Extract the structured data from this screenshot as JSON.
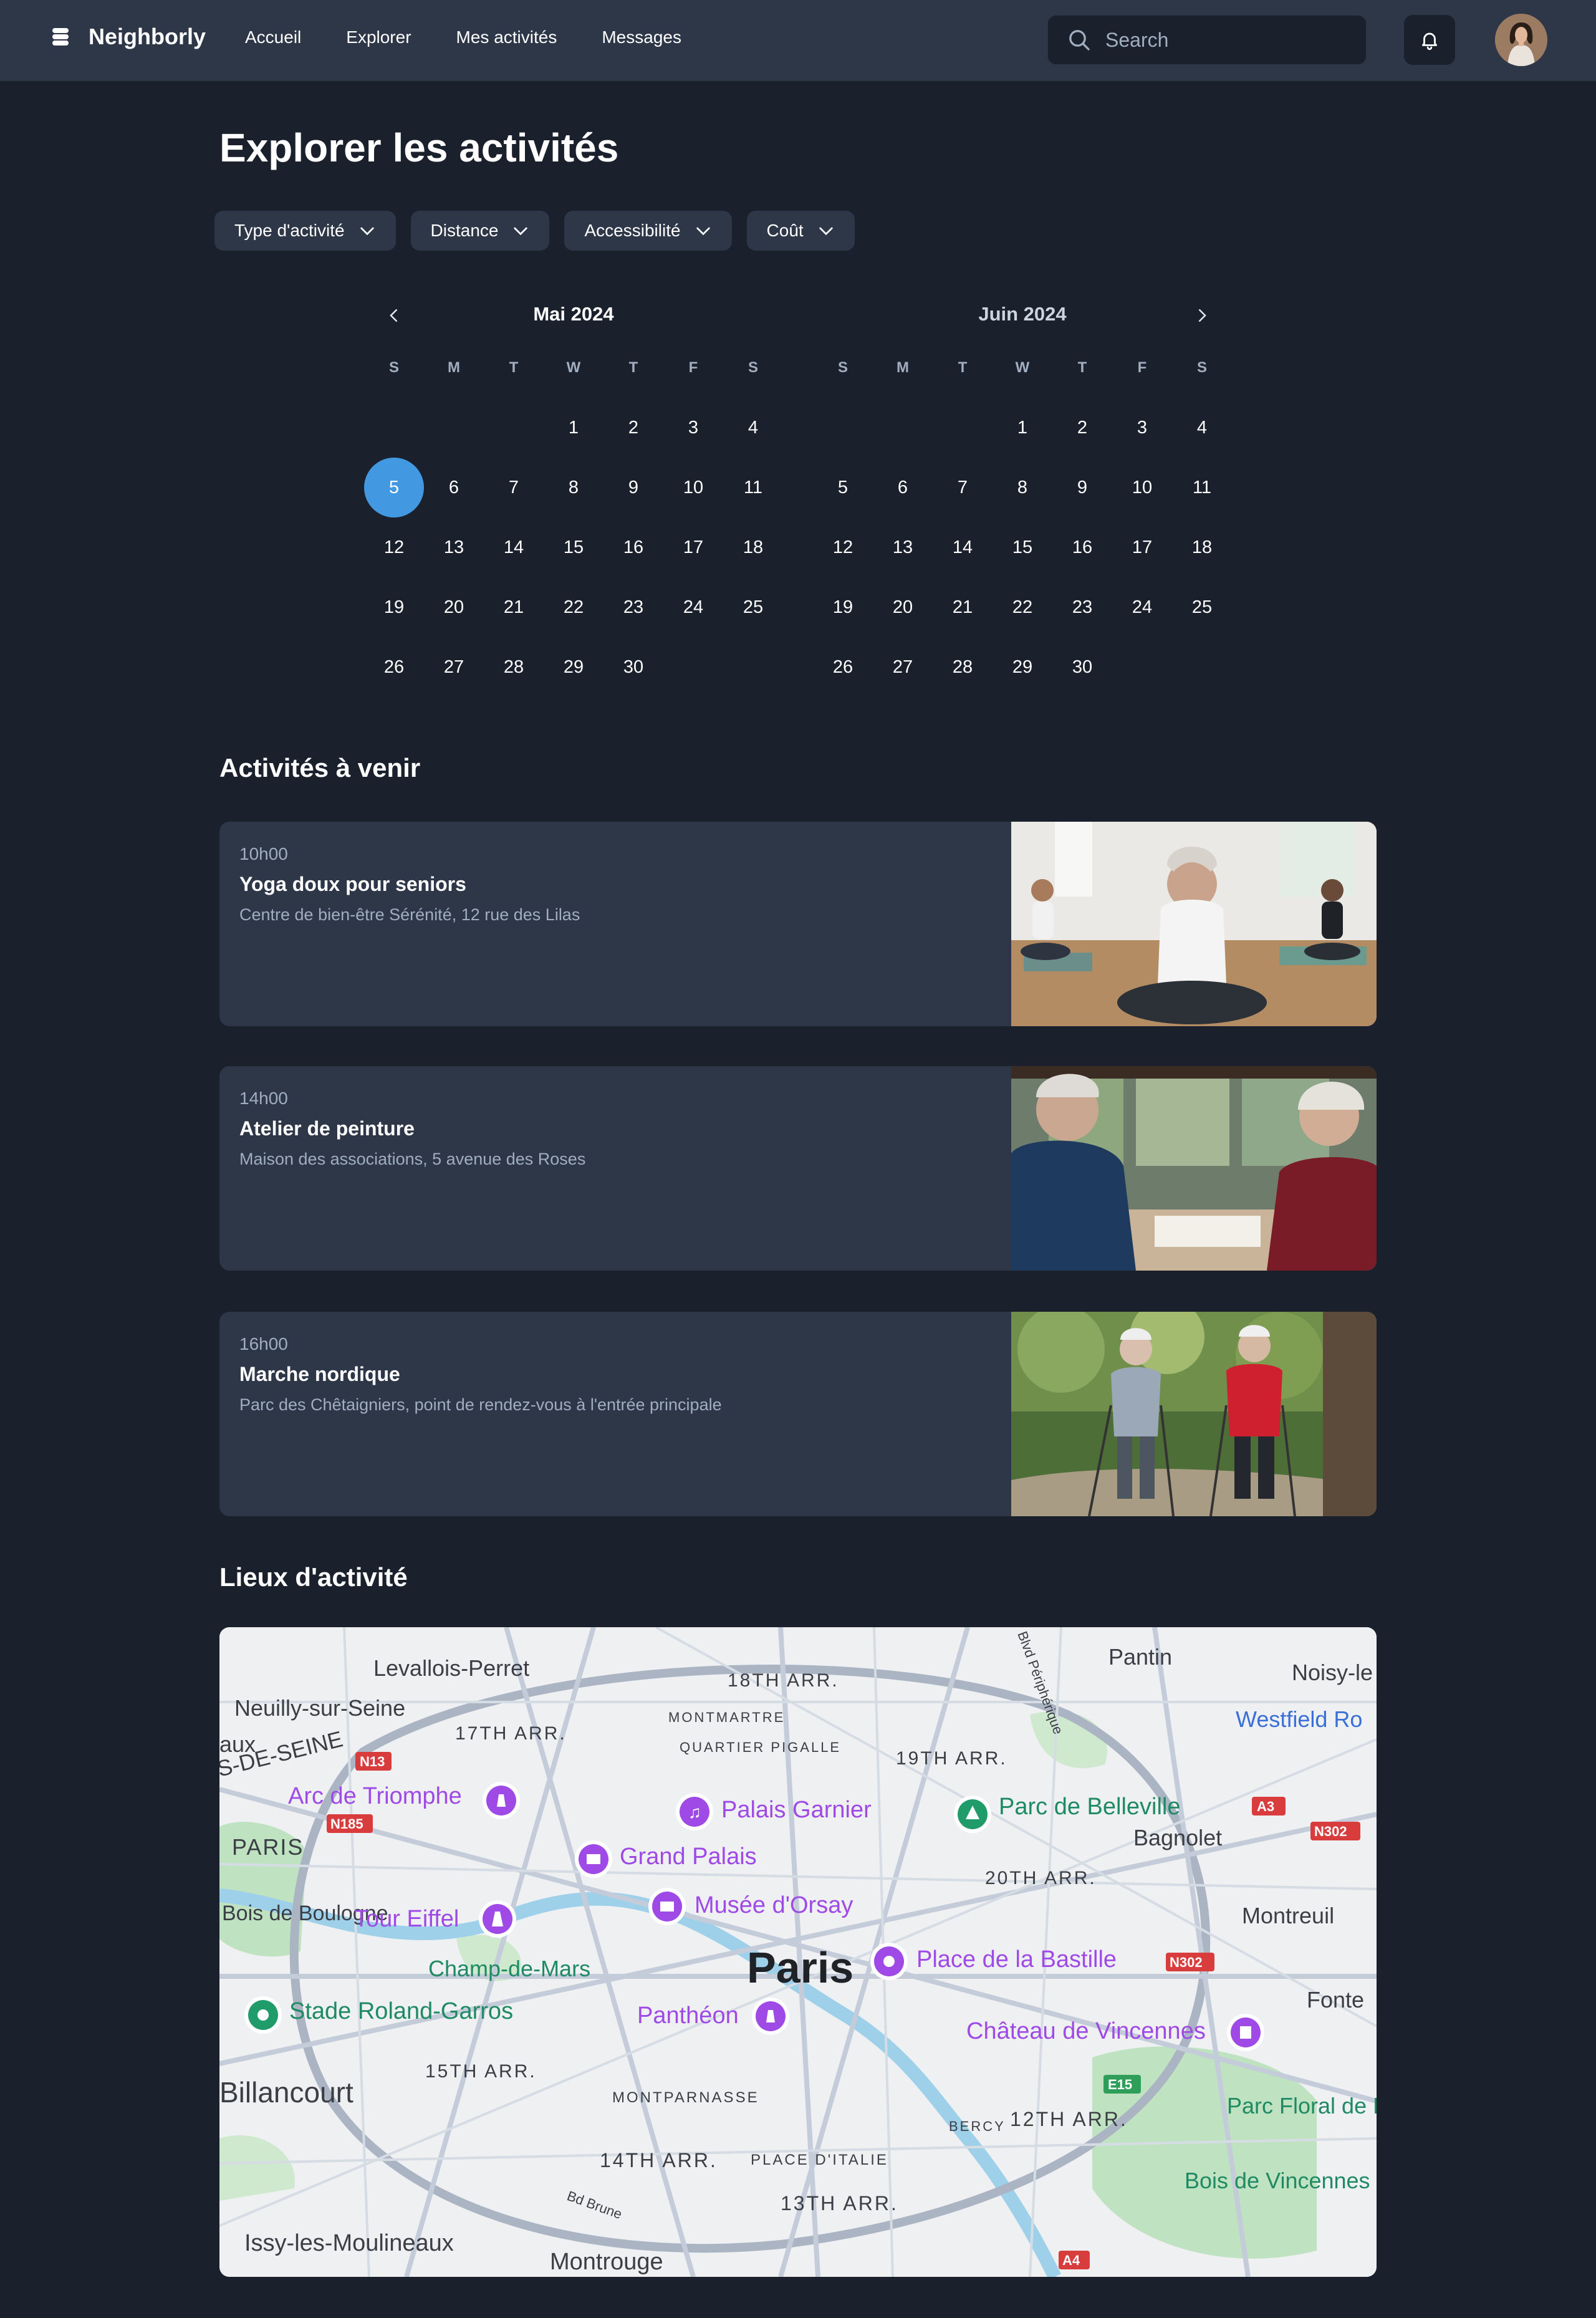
{
  "nav": {
    "brand": "Neighborly",
    "links": [
      "Accueil",
      "Explorer",
      "Mes activités",
      "Messages"
    ],
    "search_placeholder": "Search"
  },
  "page": {
    "title": "Explorer les activités",
    "filters": [
      "Type d'activité",
      "Distance",
      "Accessibilité",
      "Coût"
    ]
  },
  "calendar": {
    "weekdays": [
      "S",
      "M",
      "T",
      "W",
      "T",
      "F",
      "S"
    ],
    "months": [
      {
        "label": "Mai 2024",
        "offset": 3,
        "days": 30,
        "selected": 5
      },
      {
        "label": "Juin 2024",
        "offset": 3,
        "days": 30,
        "selected": null
      }
    ]
  },
  "upcoming": {
    "title": "Activités à venir",
    "items": [
      {
        "time": "10h00",
        "title": "Yoga doux pour seniors",
        "location": "Centre de bien-être Sérénité, 12 rue des Lilas"
      },
      {
        "time": "14h00",
        "title": "Atelier de peinture",
        "location": "Maison des associations, 5 avenue des Roses"
      },
      {
        "time": "16h00",
        "title": "Marche nordique",
        "location": "Parc des Chêtaigniers, point de rendez-vous à l'entrée principale"
      }
    ]
  },
  "locations": {
    "title": "Lieux d'activité",
    "map": {
      "city": "Paris",
      "places": [
        "Levallois-Perret",
        "Neuilly-sur-Seine",
        "18TH ARR.",
        "MONTMARTRE",
        "QUARTIER PIGALLE",
        "17TH ARR.",
        "19TH ARR.",
        "Pantin",
        "Noisy-le",
        "Westfield Ro",
        "Arc de Triomphe",
        "Palais Garnier",
        "Parc de Belleville",
        "Bagnolet",
        "PARIS",
        "Grand Palais",
        "20TH ARR.",
        "Bois de Boulogne",
        "Tour Eiffel",
        "Musée d'Orsay",
        "Montreuil",
        "Champ-de-Mars",
        "Place de la Bastille",
        "Stade Roland-Garros",
        "Panthéon",
        "Château de Vincennes",
        "Fonte",
        "15TH ARR.",
        "Billancourt",
        "MONTPARNASSE",
        "BERCY",
        "12TH ARR.",
        "Parc Floral de Paris",
        "14TH ARR.",
        "PLACE D'ITALIE",
        "Bois de Vincennes",
        "13TH ARR.",
        "Issy-les-Moulineaux",
        "Montrouge",
        "Bd Brune",
        "Blvd Périphérique",
        "S-DE-SEINE",
        "aux"
      ],
      "road_badges": [
        "N13",
        "N185",
        "A3",
        "N302",
        "N302",
        "E15",
        "A4"
      ]
    }
  },
  "colors": {
    "background": "#1a202c",
    "surface": "#2d3748",
    "accent": "#4299e1",
    "muted": "#a0aec0",
    "map_pin": "#9f49e6"
  }
}
